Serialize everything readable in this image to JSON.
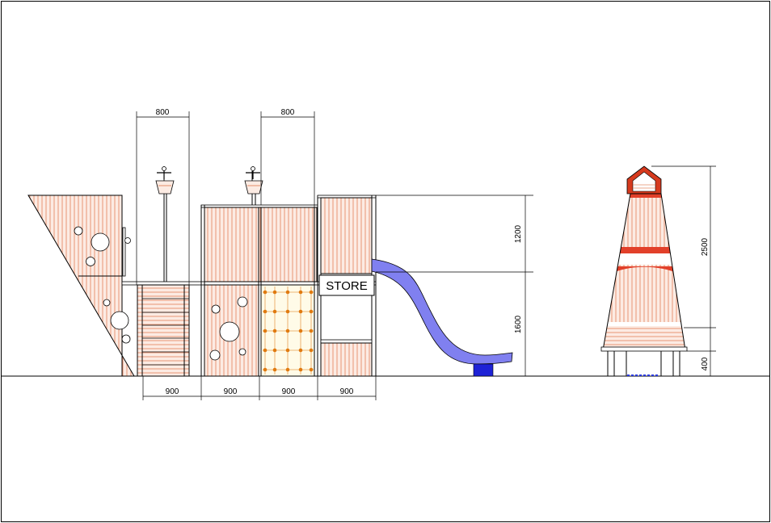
{
  "labels": {
    "store": "STORE"
  },
  "dimensions": {
    "top_width_left": "800",
    "top_width_right": "800",
    "bottom_width_1": "900",
    "bottom_width_2": "900",
    "bottom_width_3": "900",
    "bottom_width_4": "900",
    "height_upper": "1200",
    "height_lower": "1600",
    "tower_height": "2500",
    "tower_base": "400"
  },
  "colors": {
    "line": "#000000",
    "hatch": "#e07a50",
    "panel_fill": "#fbe5da",
    "slide": "#7f7ff2",
    "slide_post": "#1e22d6",
    "net_node": "#e07a10",
    "tower_band": "#e2402a",
    "tower_fill": "#f8d8c8",
    "background": "#ffffff"
  }
}
